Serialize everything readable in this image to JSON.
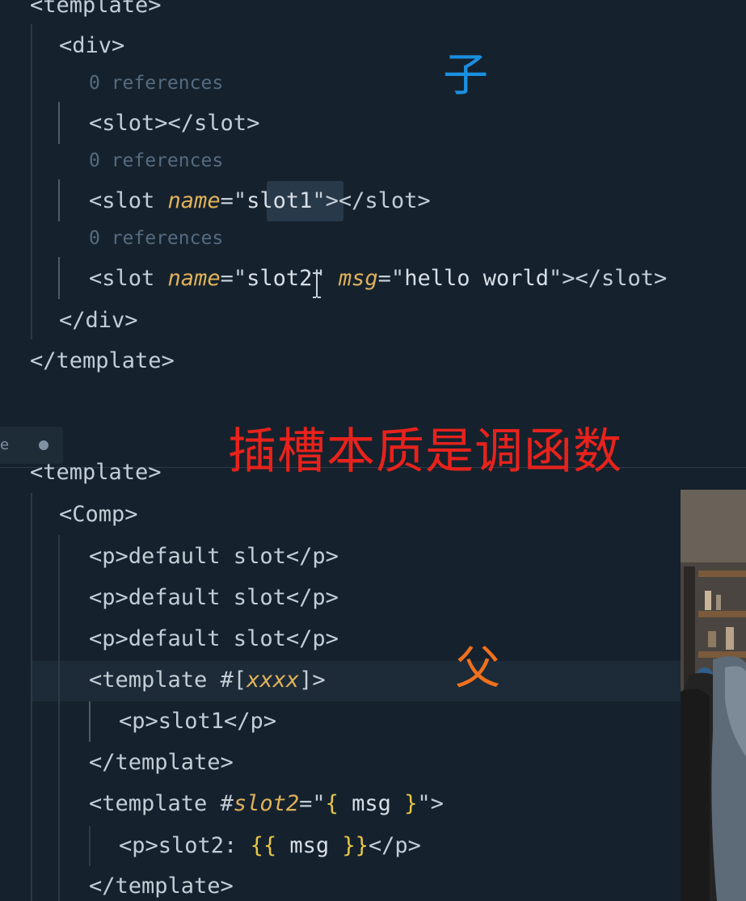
{
  "child_editor": {
    "lines": {
      "l0": "<template>",
      "l1": "<div>",
      "l3_open": "<slot></slot>",
      "l5_prefix": "<slot ",
      "l5_attr": "name",
      "l5_eq": "=\"",
      "l5_val": "slot1",
      "l5_end": "\"></slot>",
      "l7_prefix": "<slot ",
      "l7_attr": "name",
      "l7_eq": "=\"",
      "l7_val": "slot2",
      "l7_mid": "\" ",
      "l7_attr2": "msg",
      "l7_eq2": "=\"",
      "l7_val2": "hello world",
      "l7_end": "\"></slot>",
      "l8": "</div>",
      "l9": "</template>"
    },
    "references": [
      "0 references",
      "0 references",
      "0 references"
    ]
  },
  "annotations": {
    "child_label": "子",
    "center_caption": "插槽本质是调函数",
    "parent_label": "父"
  },
  "tab": {
    "label": "e"
  },
  "parent_editor": {
    "lines": {
      "p0": "<template>",
      "p1": "<Comp>",
      "p2": "<p>default slot</p>",
      "p3": "<p>default slot</p>",
      "p4": "<p>default slot</p>",
      "p5_prefix": "<template #[",
      "p5_attr": "xxxx",
      "p5_end": "]>",
      "p6": "<p>slot1</p>",
      "p7": "</template>",
      "p8_prefix": "<template #",
      "p8_attr": "slot2",
      "p8_eq": "=\"",
      "p8_brace_open": "{",
      "p8_mid": " msg ",
      "p8_brace_close": "}",
      "p8_end": "\">",
      "p9_prefix": "<p>slot2: ",
      "p9_open": "{{",
      "p9_mid": " msg ",
      "p9_close": "}}",
      "p9_end": "</p>",
      "p10": "</template>"
    }
  },
  "colors": {
    "background": "#15222d",
    "tag": "#c4cdd6",
    "attribute": "#e0b15a",
    "reference_lens": "#566b80",
    "caption_red": "#e8221c",
    "child_label_blue": "#1b8fe0",
    "parent_label_orange": "#f0701e"
  }
}
